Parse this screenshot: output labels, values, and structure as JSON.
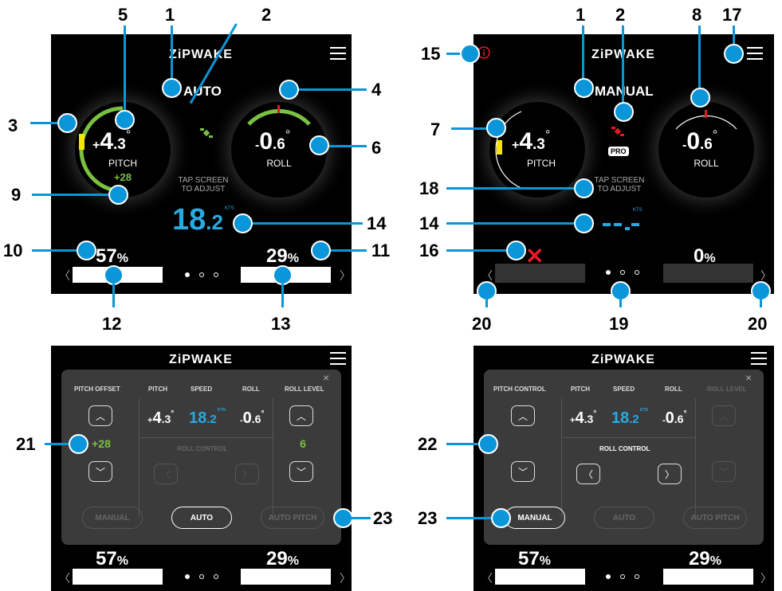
{
  "brand": "ZiPWAKE",
  "screen1": {
    "mode": "AUTO",
    "pitch": {
      "sign": "+",
      "int": "4",
      "dec": ".3",
      "deg": "°",
      "label": "PITCH",
      "offset": "+28"
    },
    "roll": {
      "sign": "-",
      "int": "0",
      "dec": ".6",
      "deg": "°",
      "label": "ROLL"
    },
    "hint_line1": "TAP SCREEN",
    "hint_line2": "TO ADJUST",
    "speed": {
      "int": "18",
      "dec": ".2",
      "unit": "KTS"
    },
    "left_pct": "57",
    "right_pct": "29",
    "pct_sign": "%",
    "left_bar_fill": 1.0,
    "right_bar_fill": 1.0
  },
  "screen2": {
    "mode": "MANUAL",
    "badge": "PRO",
    "pitch": {
      "sign": "+",
      "int": "4",
      "dec": ".3",
      "deg": "°",
      "label": "PITCH"
    },
    "roll": {
      "sign": "-",
      "int": "0",
      "dec": ".6",
      "deg": "°",
      "label": "ROLL"
    },
    "hint_line1": "TAP SCREEN",
    "hint_line2": "TO ADJUST",
    "speed_unit": "KTS",
    "error_mark": "✕",
    "right_pct": "0",
    "pct_sign": "%"
  },
  "screen3": {
    "headers": {
      "left": "PITCH OFFSET",
      "pitch": "PITCH",
      "speed": "SPEED",
      "roll": "ROLL",
      "right": "ROLL LEVEL"
    },
    "left_value": "+28",
    "right_value": "6",
    "pitch": {
      "sign": "+",
      "int": "4",
      "dec": ".3",
      "deg": "°"
    },
    "speed": {
      "int": "18",
      "dec": ".2",
      "unit": "KTS"
    },
    "roll": {
      "sign": "-",
      "int": "0",
      "dec": ".6",
      "deg": "°"
    },
    "roll_control": "ROLL CONTROL",
    "modes": [
      "MANUAL",
      "AUTO",
      "AUTO PITCH"
    ],
    "active_mode": "AUTO",
    "close": "×",
    "left_pct": "57",
    "right_pct": "29",
    "pct_sign": "%"
  },
  "screen4": {
    "headers": {
      "left": "PITCH CONTROL",
      "pitch": "PITCH",
      "speed": "SPEED",
      "roll": "ROLL",
      "right": "ROLL LEVEL"
    },
    "pitch": {
      "sign": "+",
      "int": "4",
      "dec": ".3",
      "deg": "°"
    },
    "speed": {
      "int": "18",
      "dec": ".2",
      "unit": "KTS"
    },
    "roll": {
      "sign": "-",
      "int": "0",
      "dec": ".6",
      "deg": "°"
    },
    "roll_control": "ROLL CONTROL",
    "modes": [
      "MANUAL",
      "AUTO",
      "AUTO PITCH"
    ],
    "active_mode": "MANUAL",
    "close": "×",
    "left_pct": "57",
    "right_pct": "29",
    "pct_sign": "%"
  },
  "callouts": {
    "c1": "1",
    "c2": "2",
    "c3": "3",
    "c4": "4",
    "c5": "5",
    "c6": "6",
    "c7": "7",
    "c8": "8",
    "c9": "9",
    "c10": "10",
    "c11": "11",
    "c12": "12",
    "c13": "13",
    "c14": "14",
    "c15": "15",
    "c16": "16",
    "c17": "17",
    "c18": "18",
    "c19": "19",
    "c20": "20",
    "c21": "21",
    "c22": "22",
    "c23": "23"
  },
  "colors": {
    "accent": "#0a96d8",
    "green": "#7ac143",
    "yellow": "#f5e600",
    "red": "#e31b23",
    "speed": "#29a9e0"
  },
  "icons": [
    "hamburger-menu-icon",
    "satellite-icon",
    "info-icon",
    "chevron-left-icon",
    "chevron-right-icon",
    "chevron-up-icon",
    "chevron-down-icon",
    "close-icon"
  ]
}
